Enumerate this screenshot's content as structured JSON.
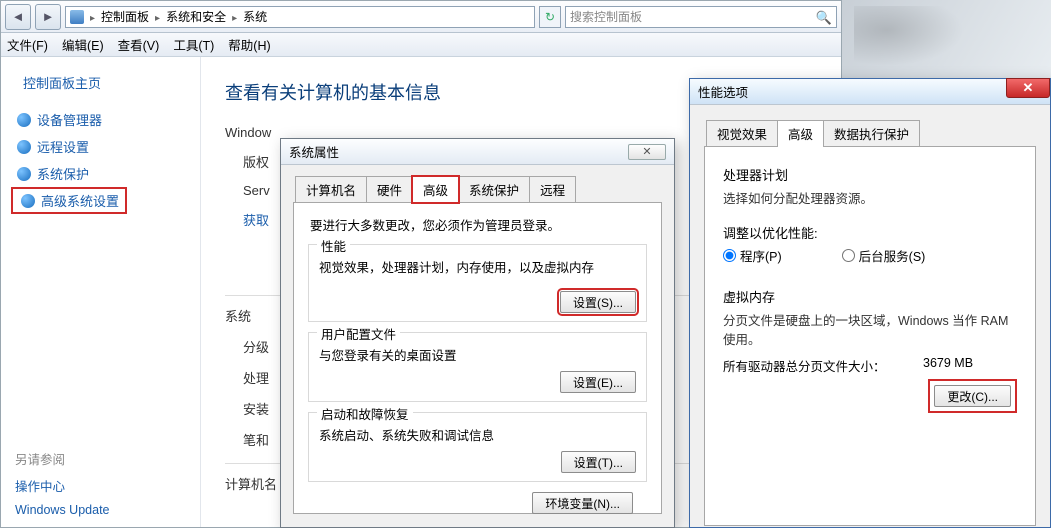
{
  "addressbar": {
    "crumb1": "控制面板",
    "crumb2": "系统和安全",
    "crumb3": "系统",
    "search_placeholder": "搜索控制面板"
  },
  "menu": {
    "file": "文件(F)",
    "edit": "编辑(E)",
    "view": "查看(V)",
    "tools": "工具(T)",
    "help": "帮助(H)"
  },
  "leftnav": {
    "home": "控制面板主页",
    "item1": "设备管理器",
    "item2": "远程设置",
    "item3": "系统保护",
    "item4": "高级系统设置",
    "seealso": "另请参阅",
    "link1": "操作中心",
    "link2": "Windows Update"
  },
  "main": {
    "heading": "查看有关计算机的基本信息",
    "winver_lbl": "Window",
    "edition_lbl": "版权",
    "sp_lbl": "Serv",
    "getmore": "获取",
    "system_lbl": "系统",
    "rating_lbl": "分级",
    "proc_lbl": "处理",
    "mem_lbl": "安装",
    "pen_lbl": "笔和",
    "cname_lbl": "计算机名"
  },
  "sysprops": {
    "title": "系统属性",
    "tab_name": "计算机名",
    "tab_hw": "硬件",
    "tab_adv": "高级",
    "tab_protect": "系统保护",
    "tab_remote": "远程",
    "note": "要进行大多数更改，您必须作为管理员登录。",
    "perf_title": "性能",
    "perf_desc": "视觉效果，处理器计划，内存使用，以及虚拟内存",
    "perf_btn": "设置(S)...",
    "user_title": "用户配置文件",
    "user_desc": "与您登录有关的桌面设置",
    "user_btn": "设置(E)...",
    "start_title": "启动和故障恢复",
    "start_desc": "系统启动、系统失败和调试信息",
    "start_btn": "设置(T)...",
    "env_btn": "环境变量(N)..."
  },
  "perf": {
    "title": "性能选项",
    "tab_visual": "视觉效果",
    "tab_adv": "高级",
    "tab_dep": "数据执行保护",
    "sched_title": "处理器计划",
    "sched_desc": "选择如何分配处理器资源。",
    "adjust_lbl": "调整以优化性能:",
    "radio_prog": "程序(P)",
    "radio_bg": "后台服务(S)",
    "vm_title": "虚拟内存",
    "vm_desc": "分页文件是硬盘上的一块区域，Windows 当作 RAM 使用。",
    "vm_total_lbl": "所有驱动器总分页文件大小：",
    "vm_total_val": "3679 MB",
    "change_btn": "更改(C)..."
  }
}
